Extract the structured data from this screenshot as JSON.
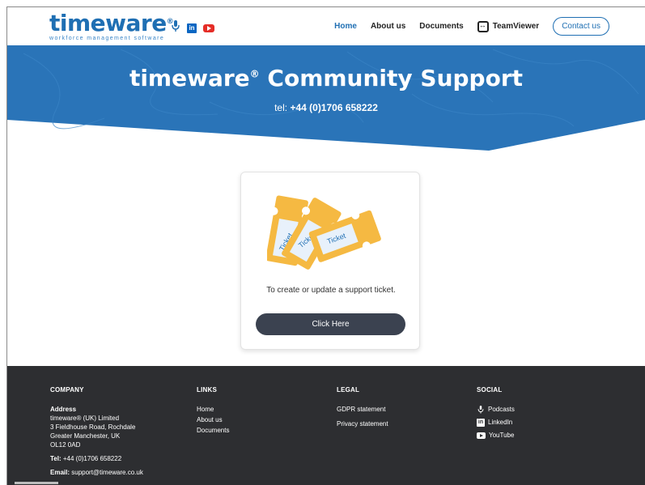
{
  "header": {
    "logo_word": "timeware",
    "logo_reg": "®",
    "logo_tagline": "workforce management software",
    "nav": {
      "home": "Home",
      "about": "About us",
      "documents": "Documents",
      "teamviewer": "TeamViewer",
      "contact": "Contact us"
    },
    "social_icons": [
      "microphone-icon",
      "linkedin-icon",
      "youtube-icon"
    ]
  },
  "hero": {
    "title_main": "timeware",
    "title_reg": "®",
    "title_rest": " Community Support",
    "tel_label": "tel:",
    "tel_number": "+44 (0)1706 658222"
  },
  "card": {
    "ticket_labels": [
      "Ticket",
      "Ticket",
      "Ticket"
    ],
    "description": "To create or update a support ticket.",
    "button_label": "Click Here"
  },
  "footer": {
    "company": {
      "heading": "COMPANY",
      "address_label": "Address",
      "address_lines": [
        "timeware® (UK) Limited",
        "3 Fieldhouse Road, Rochdale",
        "Greater Manchester, UK",
        "OL12 0AD"
      ],
      "tel_label": "Tel:",
      "tel_value": " +44 (0)1706 658222",
      "email_label": "Email:",
      "email_value": " support@timeware.co.uk"
    },
    "links": {
      "heading": "LINKS",
      "items": [
        "Home",
        "About us",
        "Documents"
      ]
    },
    "legal": {
      "heading": "LEGAL",
      "items": [
        "GDPR statement",
        "Privacy statement"
      ]
    },
    "social": {
      "heading": "SOCIAL",
      "items": [
        "Podcasts",
        "LinkedIn",
        "YouTube"
      ]
    }
  },
  "colors": {
    "brand_blue": "#1f6fb3",
    "hero_blue": "#2a74b8",
    "footer_bg": "#2d2e31",
    "button_bg": "#3b4250",
    "ticket_yellow": "#f5b942"
  }
}
